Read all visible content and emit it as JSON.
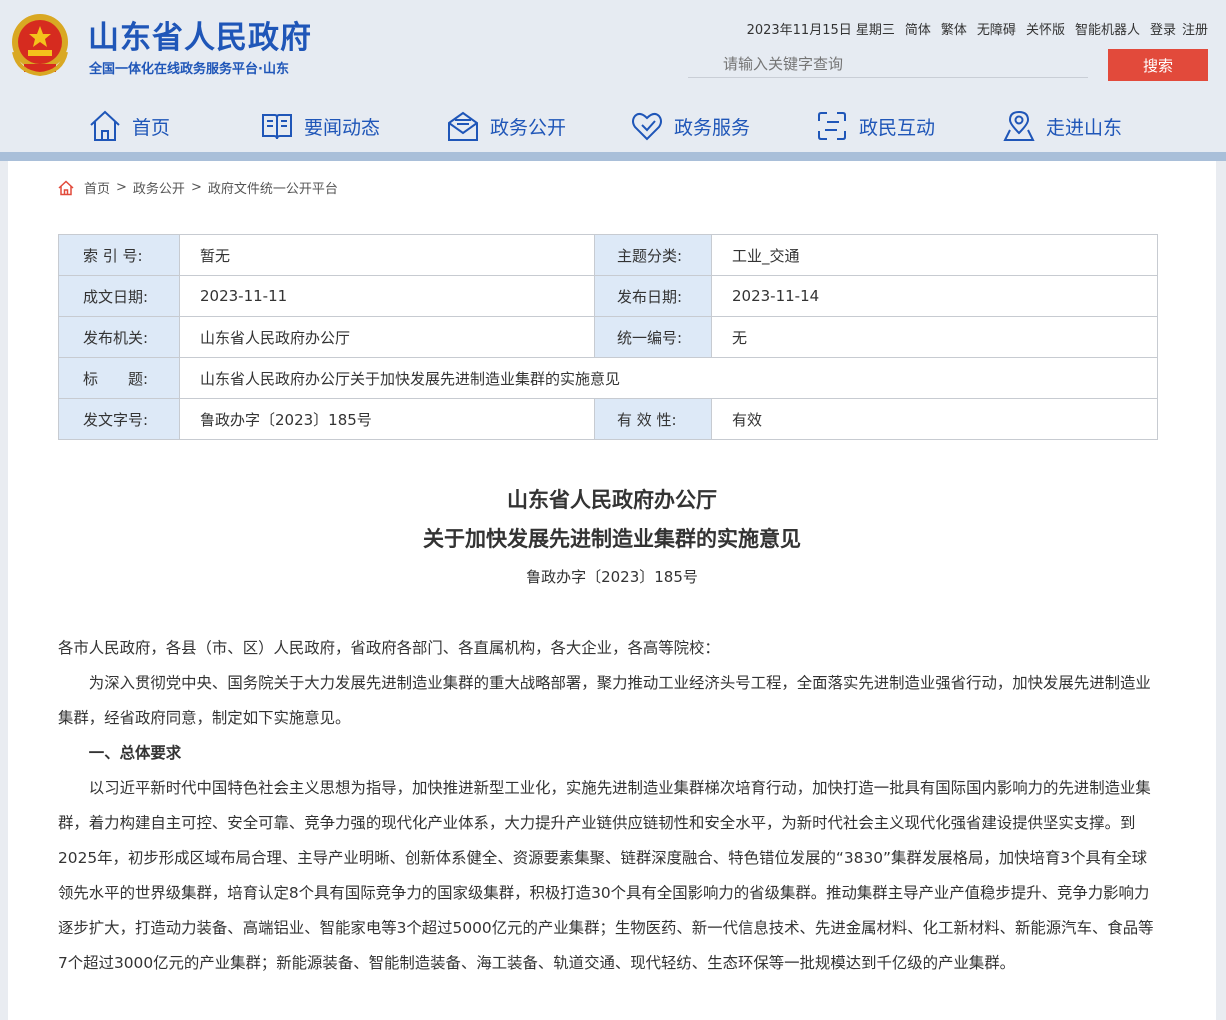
{
  "header": {
    "site_title": "山东省人民政府",
    "site_subtitle": "全国一体化在线政务服务平台·山东",
    "date": "2023年11月15日 星期三",
    "links": [
      "简体",
      "繁体",
      "无障碍",
      "关怀版",
      "智能机器人",
      "登录",
      "注册"
    ],
    "search_placeholder": "请输入关键字查询",
    "search_button": "搜索",
    "brand_color": "#1f56b8",
    "accent_color": "#e24a3b"
  },
  "nav": {
    "items": [
      {
        "label": "首页",
        "icon": "home-icon"
      },
      {
        "label": "要闻动态",
        "icon": "news-icon"
      },
      {
        "label": "政务公开",
        "icon": "mail-open-icon"
      },
      {
        "label": "政务服务",
        "icon": "heart-icon"
      },
      {
        "label": "政民互动",
        "icon": "interaction-icon"
      },
      {
        "label": "走进山东",
        "icon": "location-icon"
      }
    ]
  },
  "breadcrumb": {
    "items": [
      "首页",
      "政务公开",
      "政府文件统一公开平台"
    ],
    "separator": ">"
  },
  "meta": {
    "index_label": "索 引 号:",
    "index_value": "暂无",
    "topic_label": "主题分类:",
    "topic_value": "工业_交通",
    "written_label": "成文日期:",
    "written_value": "2023-11-11",
    "published_label": "发布日期:",
    "published_value": "2023-11-14",
    "issuer_label": "发布机关:",
    "issuer_value": "山东省人民政府办公厅",
    "serial_label": "统一编号:",
    "serial_value": "无",
    "title_label": "标　　题:",
    "title_value": "山东省人民政府办公厅关于加快发展先进制造业集群的实施意见",
    "docno_label": "发文字号:",
    "docno_value": "鲁政办字〔2023〕185号",
    "validity_label": "有 效 性:",
    "validity_value": "有效"
  },
  "document": {
    "title_line1": "山东省人民政府办公厅",
    "title_line2": "关于加快发展先进制造业集群的实施意见",
    "doc_no": "鲁政办字〔2023〕185号",
    "salutation": "各市人民政府，各县（市、区）人民政府，省政府各部门、各直属机构，各大企业，各高等院校：",
    "intro": "为深入贯彻党中央、国务院关于大力发展先进制造业集群的重大战略部署，聚力推动工业经济头号工程，全面落实先进制造业强省行动，加快发展先进制造业集群，经省政府同意，制定如下实施意见。",
    "section1_heading": "一、总体要求",
    "section1_body": "以习近平新时代中国特色社会主义思想为指导，加快推进新型工业化，实施先进制造业集群梯次培育行动，加快打造一批具有国际国内影响力的先进制造业集群，着力构建自主可控、安全可靠、竞争力强的现代化产业体系，大力提升产业链供应链韧性和安全水平，为新时代社会主义现代化强省建设提供坚实支撑。到2025年，初步形成区域布局合理、主导产业明晰、创新体系健全、资源要素集聚、链群深度融合、特色错位发展的“3830”集群发展格局，加快培育3个具有全球领先水平的世界级集群，培育认定8个具有国际竞争力的国家级集群，积极打造30个具有全国影响力的省级集群。推动集群主导产业产值稳步提升、竞争力影响力逐步扩大，打造动力装备、高端铝业、智能家电等3个超过5000亿元的产业集群；生物医药、新一代信息技术、先进金属材料、化工新材料、新能源汽车、食品等7个超过3000亿元的产业集群；新能源装备、智能制造装备、海工装备、轨道交通、现代轻纺、生态环保等一批规模达到千亿级的产业集群。"
  }
}
